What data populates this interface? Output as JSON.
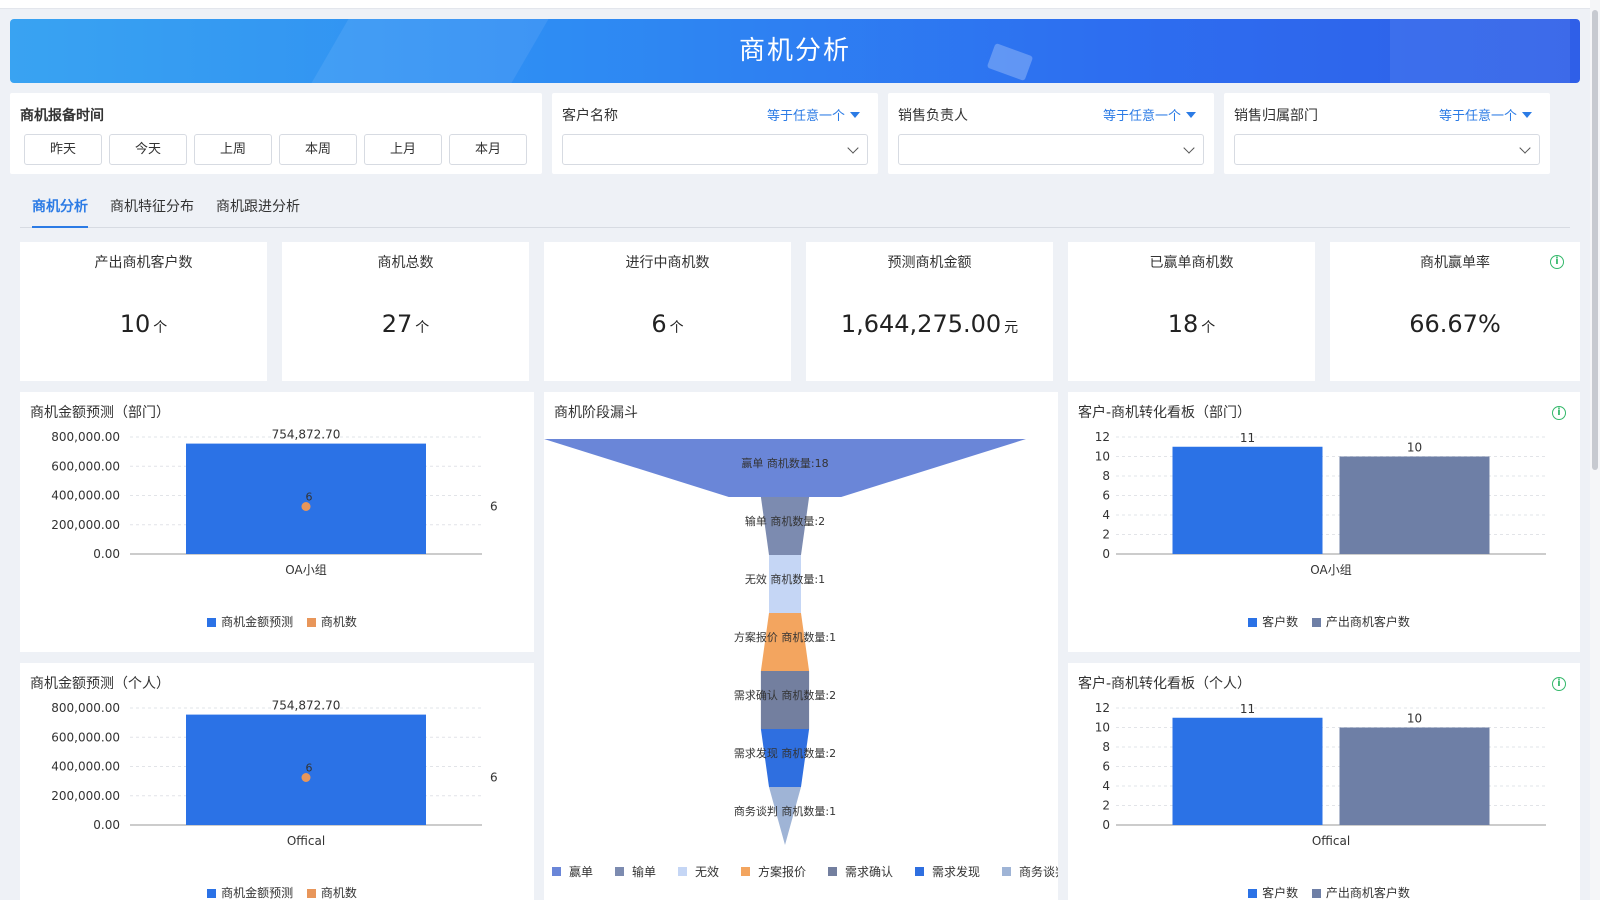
{
  "banner": {
    "title": "商机分析"
  },
  "filters": {
    "time": {
      "label": "商机报备时间",
      "buttons": [
        "昨天",
        "今天",
        "上周",
        "本周",
        "上月",
        "本月"
      ]
    },
    "customer": {
      "label": "客户名称",
      "op": "等于任意一个"
    },
    "owner": {
      "label": "销售负责人",
      "op": "等于任意一个"
    },
    "dept": {
      "label": "销售归属部门",
      "op": "等于任意一个"
    }
  },
  "tabs": [
    "商机分析",
    "商机特征分布",
    "商机跟进分析"
  ],
  "kpis": [
    {
      "title": "产出商机客户数",
      "value": "10",
      "unit": "个"
    },
    {
      "title": "商机总数",
      "value": "27",
      "unit": "个"
    },
    {
      "title": "进行中商机数",
      "value": "6",
      "unit": "个"
    },
    {
      "title": "预测商机金额",
      "value": "1,644,275.00",
      "unit": "元"
    },
    {
      "title": "已赢单商机数",
      "value": "18",
      "unit": "个"
    },
    {
      "title": "商机赢单率",
      "value": "66.67%",
      "unit": ""
    }
  ],
  "panels": {
    "amount_dept": {
      "title": "商机金额预测（部门）",
      "legend": [
        "商机金额预测",
        "商机数"
      ]
    },
    "amount_person": {
      "title": "商机金额预测（个人）",
      "legend": [
        "商机金额预测",
        "商机数"
      ]
    },
    "funnel": {
      "title": "商机阶段漏斗"
    },
    "conv_dept": {
      "title": "客户-商机转化看板（部门）",
      "legend": [
        "客户数",
        "产出商机客户数"
      ]
    },
    "conv_person": {
      "title": "客户-商机转化看板（个人）",
      "legend": [
        "客户数",
        "产出商机客户数"
      ]
    }
  },
  "colors": {
    "blue": "#2b72e6",
    "orange": "#e8965a",
    "slate": "#6e7fa6",
    "accent": "#2b7be5",
    "info": "#34b86a"
  },
  "chart_data": [
    {
      "id": "amount_dept",
      "type": "bar",
      "categories": [
        "OA小组"
      ],
      "series": [
        {
          "name": "商机金额预测",
          "values": [
            754872.7
          ],
          "labels": [
            "754,872.70"
          ]
        },
        {
          "name": "商机数",
          "type": "scatter",
          "values": [
            6
          ],
          "axis": "right"
        }
      ],
      "yticks": [
        "800,000.00",
        "600,000.00",
        "400,000.00",
        "200,000.00",
        "0.00"
      ],
      "ylim": [
        0,
        800000
      ],
      "y2ticks": [
        "6"
      ]
    },
    {
      "id": "amount_person",
      "type": "bar",
      "categories": [
        "Offical"
      ],
      "series": [
        {
          "name": "商机金额预测",
          "values": [
            754872.7
          ],
          "labels": [
            "754,872.70"
          ]
        },
        {
          "name": "商机数",
          "type": "scatter",
          "values": [
            6
          ],
          "axis": "right"
        }
      ],
      "yticks": [
        "800,000.00",
        "600,000.00",
        "400,000.00",
        "200,000.00",
        "0.00"
      ],
      "ylim": [
        0,
        800000
      ],
      "y2ticks": [
        "6"
      ]
    },
    {
      "id": "funnel",
      "type": "funnel",
      "stages": [
        {
          "name": "赢单",
          "label": "赢单 商机数量:18",
          "value": 18,
          "color": "#6a86d8"
        },
        {
          "name": "输单",
          "label": "输单 商机数量:2",
          "value": 2,
          "color": "#7c8bb0"
        },
        {
          "name": "无效",
          "label": "无效 商机数量:1",
          "value": 1,
          "color": "#c5d6f5"
        },
        {
          "name": "方案报价",
          "label": "方案报价 商机数量:1",
          "value": 1,
          "color": "#f3a55f"
        },
        {
          "name": "需求确认",
          "label": "需求确认 商机数量:2",
          "value": 2,
          "color": "#737f9f"
        },
        {
          "name": "需求发现",
          "label": "需求发现 商机数量:2",
          "value": 2,
          "color": "#2f6fe0"
        },
        {
          "name": "商务谈判",
          "label": "商务谈判 商机数量:1",
          "value": 1,
          "color": "#9fb4d6"
        }
      ]
    },
    {
      "id": "conv_dept",
      "type": "bar",
      "categories": [
        "OA小组"
      ],
      "series": [
        {
          "name": "客户数",
          "values": [
            11
          ]
        },
        {
          "name": "产出商机客户数",
          "values": [
            10
          ]
        }
      ],
      "yticks": [
        "12",
        "10",
        "8",
        "6",
        "4",
        "2",
        "0"
      ],
      "ylim": [
        0,
        12
      ]
    },
    {
      "id": "conv_person",
      "type": "bar",
      "categories": [
        "Offical"
      ],
      "series": [
        {
          "name": "客户数",
          "values": [
            11
          ]
        },
        {
          "name": "产出商机客户数",
          "values": [
            10
          ]
        }
      ],
      "yticks": [
        "12",
        "10",
        "8",
        "6",
        "4",
        "2",
        "0"
      ],
      "ylim": [
        0,
        12
      ]
    }
  ]
}
